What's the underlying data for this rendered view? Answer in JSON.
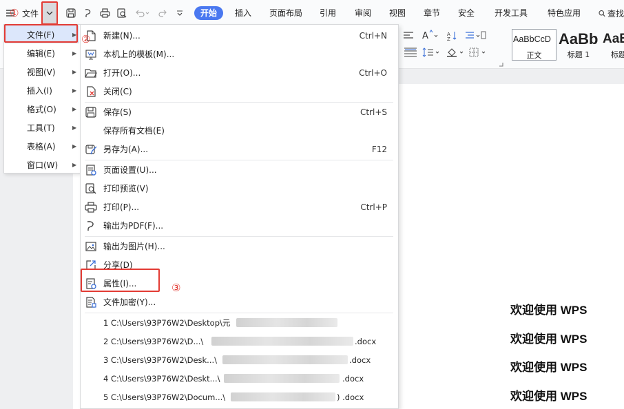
{
  "topbar": {
    "file_label": "文件",
    "tabs": [
      {
        "label": "开始",
        "active": true
      },
      {
        "label": "插入",
        "active": false
      },
      {
        "label": "页面布局",
        "active": false
      },
      {
        "label": "引用",
        "active": false
      },
      {
        "label": "审阅",
        "active": false
      },
      {
        "label": "视图",
        "active": false
      },
      {
        "label": "章节",
        "active": false
      },
      {
        "label": "安全",
        "active": false
      },
      {
        "label": "开发工具",
        "active": false
      },
      {
        "label": "特色应用",
        "active": false
      }
    ],
    "search_label": "查找"
  },
  "ribbon": {
    "styles": [
      {
        "preview": "AaBbCcD",
        "name": "正文"
      },
      {
        "preview": "AaBb",
        "name": "标题 1"
      },
      {
        "preview": "AaB",
        "name": "标题"
      }
    ]
  },
  "main_menu": {
    "items": [
      {
        "label": "文件(F)"
      },
      {
        "label": "编辑(E)"
      },
      {
        "label": "视图(V)"
      },
      {
        "label": "插入(I)"
      },
      {
        "label": "格式(O)"
      },
      {
        "label": "工具(T)"
      },
      {
        "label": "表格(A)"
      },
      {
        "label": "窗口(W)"
      }
    ]
  },
  "file_submenu": {
    "items": [
      {
        "label": "新建(N)...",
        "shortcut": "Ctrl+N",
        "icon": "new-document-icon"
      },
      {
        "label": "本机上的模板(M)...",
        "shortcut": "",
        "icon": "template-icon"
      },
      {
        "label": "打开(O)...",
        "shortcut": "Ctrl+O",
        "icon": "folder-open-icon"
      },
      {
        "label": "关闭(C)",
        "shortcut": "",
        "icon": "close-document-icon"
      },
      {
        "label": "保存(S)",
        "shortcut": "Ctrl+S",
        "icon": "save-icon"
      },
      {
        "label": "保存所有文档(E)",
        "shortcut": "",
        "icon": ""
      },
      {
        "label": "另存为(A)...",
        "shortcut": "F12",
        "icon": "save-as-icon"
      },
      {
        "label": "页面设置(U)...",
        "shortcut": "",
        "icon": "page-setup-icon"
      },
      {
        "label": "打印预览(V)",
        "shortcut": "",
        "icon": "print-preview-icon"
      },
      {
        "label": "打印(P)...",
        "shortcut": "Ctrl+P",
        "icon": "print-icon"
      },
      {
        "label": "输出为PDF(F)...",
        "shortcut": "",
        "icon": "export-pdf-icon"
      },
      {
        "label": "输出为图片(H)...",
        "shortcut": "",
        "icon": "export-image-icon"
      },
      {
        "label": "分享(D)",
        "shortcut": "",
        "icon": "share-icon"
      },
      {
        "label": "属性(I)...",
        "shortcut": "",
        "icon": "properties-icon"
      },
      {
        "label": "文件加密(Y)...",
        "shortcut": "",
        "icon": "encrypt-icon"
      }
    ],
    "recent": [
      {
        "label": "1 C:\\Users\\93P76W2\\Desktop\\元",
        "suffix": ""
      },
      {
        "label": "2 C:\\Users\\93P76W2\\D...\\",
        "suffix": ".docx"
      },
      {
        "label": "3 C:\\Users\\93P76W2\\Desk...\\",
        "suffix": ".docx"
      },
      {
        "label": "4 C:\\Users\\93P76W2\\Deskt...\\",
        "suffix": ".docx"
      },
      {
        "label": "5 C:\\Users\\93P76W2\\Docum...\\",
        "suffix": ") .docx"
      }
    ]
  },
  "annotations": {
    "step1": "①",
    "step2": "②",
    "step3": "③"
  },
  "document": {
    "lines": [
      "欢迎使用 WPS",
      "欢迎使用 WPS",
      "欢迎使用 WPS",
      "欢迎使用 WPS"
    ]
  },
  "colors": {
    "accent": "#4a78f0",
    "highlight_red": "#e33b34",
    "menu_hover": "#dce7fb"
  }
}
